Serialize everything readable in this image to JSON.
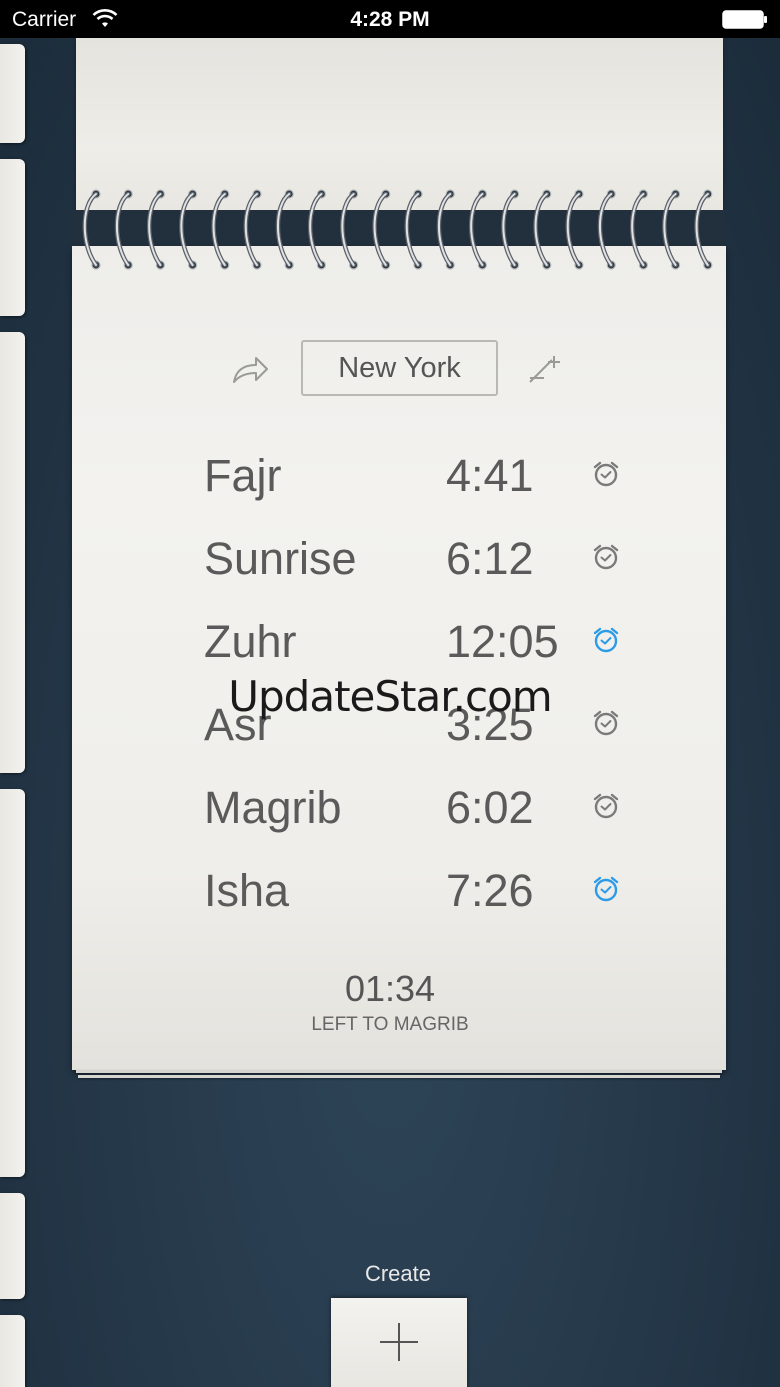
{
  "status_bar": {
    "carrier": "Carrier",
    "time": "4:28 PM"
  },
  "location": {
    "city": "New York"
  },
  "prayers": [
    {
      "name": "Fajr",
      "time": "4:41",
      "alarm_on": false
    },
    {
      "name": "Sunrise",
      "time": "6:12",
      "alarm_on": false
    },
    {
      "name": "Zuhr",
      "time": "12:05",
      "alarm_on": true
    },
    {
      "name": "Asr",
      "time": "3:25",
      "alarm_on": false
    },
    {
      "name": "Magrib",
      "time": "6:02",
      "alarm_on": false
    },
    {
      "name": "Isha",
      "time": "7:26",
      "alarm_on": true
    }
  ],
  "countdown": {
    "value": "01:34",
    "label": "LEFT TO MAGRIB"
  },
  "watermark": "UpdateStar.com",
  "create": {
    "label": "Create"
  },
  "colors": {
    "alarm_active": "#2b9be8",
    "alarm_inactive": "#7a7a7a",
    "background": "#243748"
  },
  "icons": {
    "share": "share-arrow-icon",
    "add_location": "add-location-icon",
    "alarm": "alarm-clock-icon",
    "create": "plus-icon"
  }
}
